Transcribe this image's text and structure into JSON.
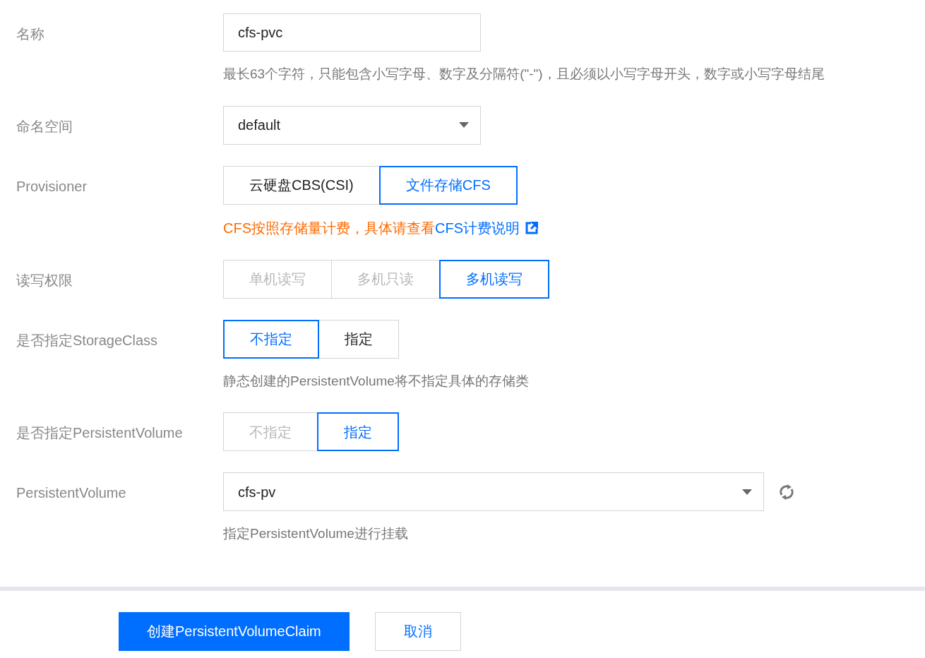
{
  "fields": [
    {
      "kind": "input",
      "label": "名称",
      "value": "cfs-pvc",
      "hint": "最长63个字符，只能包含小写字母、数字及分隔符(\"-\")，且必须以小写字母开头，数字或小写字母结尾"
    },
    {
      "kind": "select",
      "label": "命名空间",
      "value": "default"
    },
    {
      "kind": "segmented",
      "label": "Provisioner",
      "options": [
        {
          "label": "云硬盘CBS(CSI)",
          "selected": false,
          "disabled": false
        },
        {
          "label": "文件存储CFS",
          "selected": true,
          "disabled": false
        }
      ],
      "note": {
        "text": "CFS按照存储量计费，具体请查看",
        "link": "CFS计费说明"
      }
    },
    {
      "kind": "segmented",
      "label": "读写权限",
      "options": [
        {
          "label": "单机读写",
          "selected": false,
          "disabled": true
        },
        {
          "label": "多机只读",
          "selected": false,
          "disabled": true
        },
        {
          "label": "多机读写",
          "selected": true,
          "disabled": false
        }
      ]
    },
    {
      "kind": "segmented",
      "label": "是否指定StorageClass",
      "options": [
        {
          "label": "不指定",
          "selected": true,
          "disabled": false
        },
        {
          "label": "指定",
          "selected": false,
          "disabled": false
        }
      ],
      "hint": "静态创建的PersistentVolume将不指定具体的存储类"
    },
    {
      "kind": "segmented",
      "label": "是否指定PersistentVolume",
      "options": [
        {
          "label": "不指定",
          "selected": false,
          "disabled": true
        },
        {
          "label": "指定",
          "selected": true,
          "disabled": false
        }
      ]
    },
    {
      "kind": "select-refresh",
      "label": "PersistentVolume",
      "value": "cfs-pv",
      "hint": "指定PersistentVolume进行挂载"
    }
  ],
  "buttons": [
    {
      "label": "创建PersistentVolumeClaim",
      "kind": "primary"
    },
    {
      "label": "取消",
      "kind": "default"
    }
  ]
}
